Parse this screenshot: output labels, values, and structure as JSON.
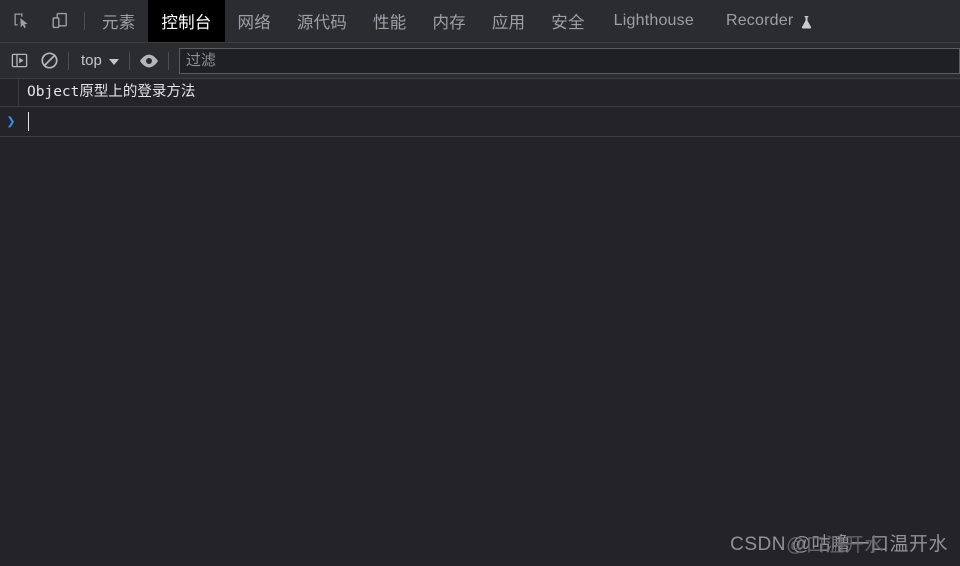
{
  "window": {
    "background": "#242428",
    "panel_background": "#2b2c30",
    "accent": "#3b8eea",
    "active_tab_background": "#000000",
    "text_color": "#9aa0a6"
  },
  "tabbar": {
    "icons": [
      {
        "name": "inspect-element-icon",
        "title": "检查元素"
      },
      {
        "name": "device-toolbar-icon",
        "title": "切换设备工具栏"
      }
    ],
    "tabs": [
      {
        "id": "elements",
        "label": "元素",
        "active": false,
        "lang": "zh"
      },
      {
        "id": "console",
        "label": "控制台",
        "active": true,
        "lang": "zh"
      },
      {
        "id": "network",
        "label": "网络",
        "active": false,
        "lang": "zh"
      },
      {
        "id": "sources",
        "label": "源代码",
        "active": false,
        "lang": "zh"
      },
      {
        "id": "performance",
        "label": "性能",
        "active": false,
        "lang": "zh"
      },
      {
        "id": "memory",
        "label": "内存",
        "active": false,
        "lang": "zh"
      },
      {
        "id": "application",
        "label": "应用",
        "active": false,
        "lang": "zh"
      },
      {
        "id": "security",
        "label": "安全",
        "active": false,
        "lang": "zh"
      },
      {
        "id": "lighthouse",
        "label": "Lighthouse",
        "active": false,
        "lang": "en"
      },
      {
        "id": "recorder",
        "label": "Recorder",
        "active": false,
        "lang": "en",
        "badge_icon": "flask-experiment-icon"
      }
    ]
  },
  "filterbar": {
    "sidebar_toggle": {
      "name": "console-sidebar-icon"
    },
    "clear_console": {
      "name": "clear-console-icon"
    },
    "context_selector": {
      "value": "top"
    },
    "live_expression": {
      "name": "eye-icon"
    },
    "filter": {
      "placeholder": "过滤",
      "value": ""
    }
  },
  "console": {
    "messages": [
      {
        "text": "Object原型上的登录方法",
        "type": "log"
      }
    ],
    "prompt": {
      "arrow": "❯",
      "value": ""
    }
  },
  "watermark": {
    "text": "CSDN @咕噜一口温开水",
    "ghost_text": "@口温开水"
  }
}
